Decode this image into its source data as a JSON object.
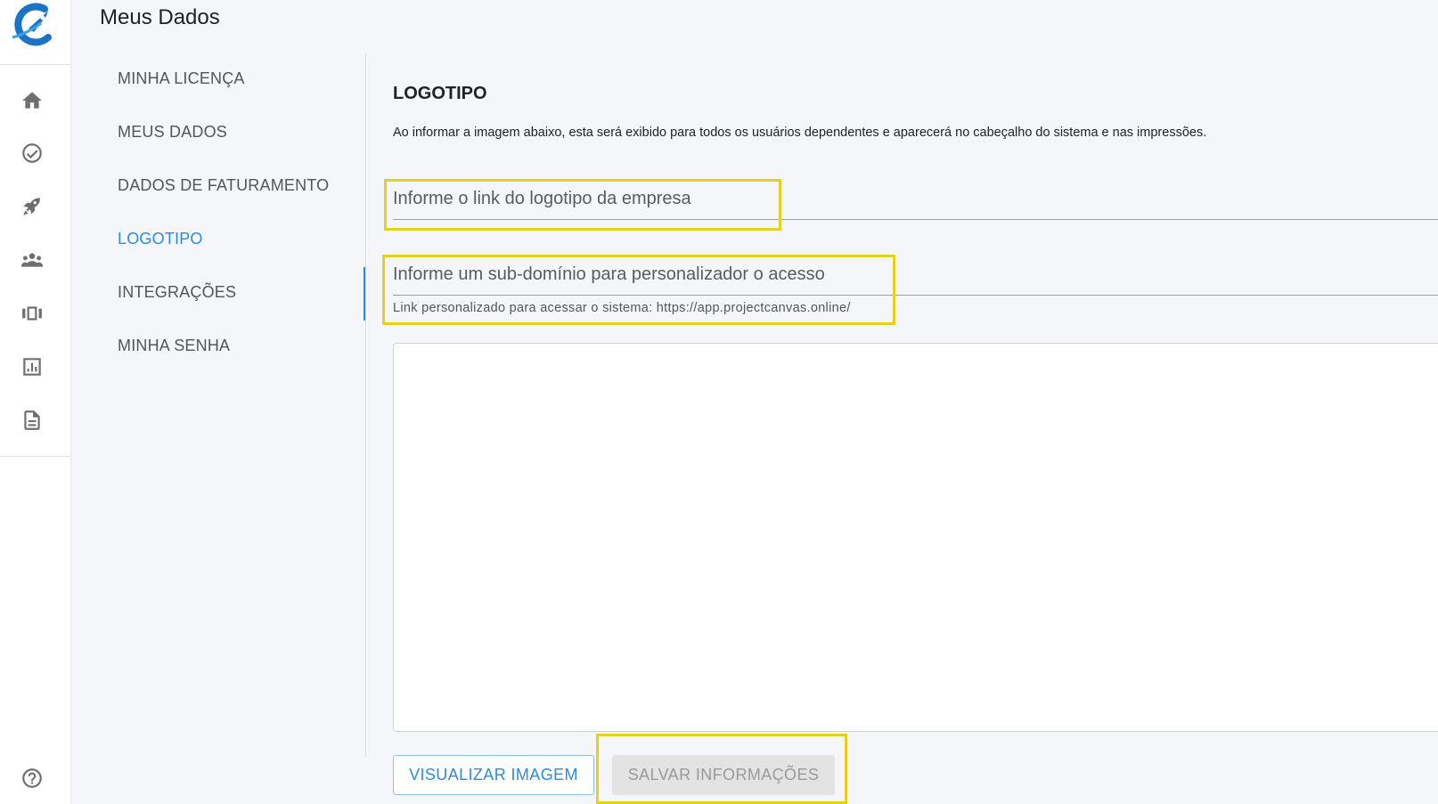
{
  "page": {
    "title": "Meus Dados"
  },
  "rail": {
    "icons": [
      "home-icon",
      "check-circle-icon",
      "rocket-icon",
      "people-icon",
      "carousel-icon",
      "chart-icon",
      "document-icon",
      "help-icon"
    ]
  },
  "subnav": {
    "items": [
      {
        "label": "MINHA LICENÇA",
        "active": false
      },
      {
        "label": "MEUS DADOS",
        "active": false
      },
      {
        "label": "DADOS DE FATURAMENTO",
        "active": false
      },
      {
        "label": "LOGOTIPO",
        "active": true
      },
      {
        "label": "INTEGRAÇÕES",
        "active": false
      },
      {
        "label": "MINHA SENHA",
        "active": false
      }
    ]
  },
  "main": {
    "section_title": "LOGOTIPO",
    "description": "Ao informar a imagem abaixo, esta será exibido para todos os usuários dependentes e aparecerá no cabeçalho do sistema e nas impressões.",
    "logo_link": {
      "placeholder": "Informe o link do logotipo da empresa",
      "value": ""
    },
    "subdomain": {
      "placeholder": "Informe um sub-domínio para personalizador o acesso",
      "value": "",
      "helper": "Link personalizado para acessar o sistema: https://app.projectcanvas.online/"
    },
    "buttons": {
      "view_label": "VISUALIZAR IMAGEM",
      "save_label": "SALVAR INFORMAÇÕES"
    }
  },
  "colors": {
    "accent": "#2b8be0",
    "highlight": "#e6cf1f",
    "background": "#f4f6fa"
  }
}
